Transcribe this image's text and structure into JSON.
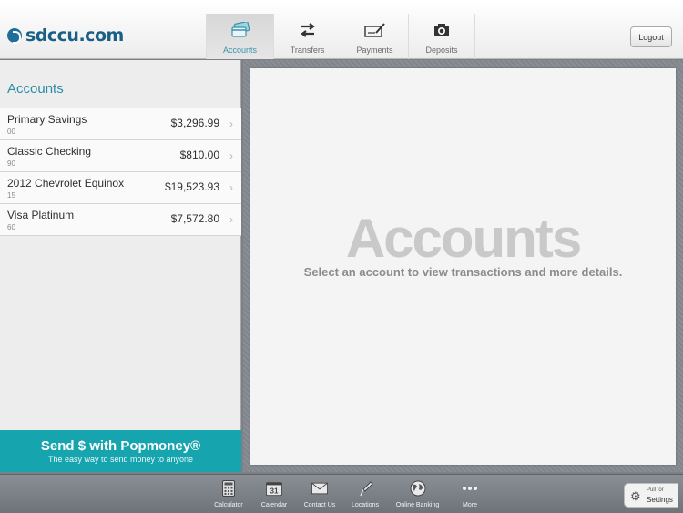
{
  "header": {
    "logo_text": "sdccu.com",
    "tabs": [
      {
        "label": "Accounts",
        "icon": "accounts-card-icon"
      },
      {
        "label": "Transfers",
        "icon": "transfer-arrows-icon"
      },
      {
        "label": "Payments",
        "icon": "check-pen-icon"
      },
      {
        "label": "Deposits",
        "icon": "camera-icon"
      }
    ],
    "logout_label": "Logout"
  },
  "sidebar": {
    "title": "Accounts",
    "accounts": [
      {
        "name": "Primary Savings",
        "number": "00",
        "balance": "$3,296.99"
      },
      {
        "name": "Classic Checking",
        "number": "90",
        "balance": "$810.00"
      },
      {
        "name": "2012 Chevrolet Equinox",
        "number": "15",
        "balance": "$19,523.93"
      },
      {
        "name": "Visa Platinum",
        "number": "60",
        "balance": "$7,572.80"
      }
    ],
    "promo": {
      "title": "Send $ with Popmoney®",
      "subtitle": "The easy way to send money to anyone"
    }
  },
  "main": {
    "title": "Accounts",
    "message": "Select an account to view transactions and more details."
  },
  "dock": {
    "items": [
      {
        "label": "Calculator",
        "icon": "calculator-icon"
      },
      {
        "label": "Calendar",
        "icon": "calendar-icon",
        "badge": "31"
      },
      {
        "label": "Contact Us",
        "icon": "envelope-icon"
      },
      {
        "label": "Locations",
        "icon": "location-pin-icon"
      },
      {
        "label": "Online Banking",
        "icon": "globe-icon"
      },
      {
        "label": "More",
        "icon": "more-dots-icon"
      }
    ]
  },
  "settings_pull": {
    "top_label": "Pull for",
    "label": "Settings"
  },
  "colors": {
    "accent_teal": "#16a4af",
    "title_blue": "#2a8ea8",
    "brand_blue": "#1a5f85"
  }
}
